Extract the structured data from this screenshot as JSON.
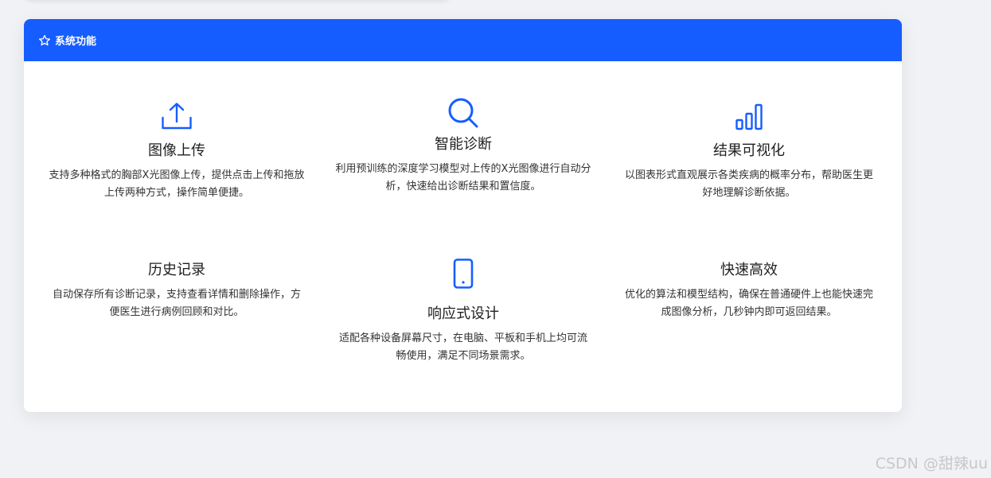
{
  "header": {
    "icon": "star-icon",
    "title": "系统功能",
    "bg_color": "#165dff"
  },
  "features": [
    {
      "icon": "upload-icon",
      "title": "图像上传",
      "desc": "支持多种格式的胸部X光图像上传，提供点击上传和拖放上传两种方式，操作简单便捷。"
    },
    {
      "icon": "search-icon",
      "title": "智能诊断",
      "desc": "利用预训练的深度学习模型对上传的X光图像进行自动分析，快速给出诊断结果和置信度。"
    },
    {
      "icon": "bar-chart-icon",
      "title": "结果可视化",
      "desc": "以图表形式直观展示各类疾病的概率分布，帮助医生更好地理解诊断依据。"
    },
    {
      "icon": "history-icon",
      "title": "历史记录",
      "desc": "自动保存所有诊断记录，支持查看详情和删除操作，方便医生进行病例回顾和对比。"
    },
    {
      "icon": "mobile-icon",
      "title": "响应式设计",
      "desc": "适配各种设备屏幕尺寸，在电脑、平板和手机上均可流畅使用，满足不同场景需求。"
    },
    {
      "icon": "bolt-icon",
      "title": "快速高效",
      "desc": "优化的算法和模型结构，确保在普通硬件上也能快速完成图像分析，几秒钟内即可返回结果。"
    }
  ],
  "watermark": "CSDN @甜辣uu"
}
